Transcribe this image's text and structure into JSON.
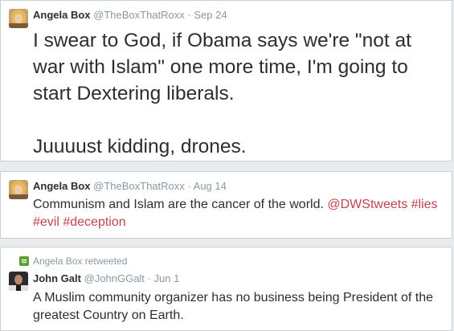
{
  "tweets": [
    {
      "author": "Angela Box",
      "handle": "@TheBoxThatRoxx",
      "separator": "·",
      "time": "Sep 24",
      "text": "I swear to God, if Obama says we're \"not at war with Islam\" one more time, I'm going to start Dextering liberals.\n\nJuuuust kidding, drones."
    },
    {
      "author": "Angela Box",
      "handle": "@TheBoxThatRoxx",
      "separator": "·",
      "time": "Aug 14",
      "text_plain": "Communism and Islam are the cancer of the world. ",
      "mention": "@DWStweets",
      "hashtags": [
        "#lies",
        "#evil",
        "#deception"
      ]
    },
    {
      "retweet_label": "Angela Box retweeted",
      "author": "John Galt",
      "handle": "@JohnGGalt",
      "separator": "·",
      "time": "Jun 1",
      "text": "A Muslim community organizer has no business being President of the greatest Country on Earth."
    }
  ],
  "icons": {
    "avatar_angela": "avatar-blonde-woman",
    "avatar_john": "avatar-dark-man",
    "retweet": "retweet-icon"
  },
  "colors": {
    "link": "#c0424f",
    "retweet_green": "#5c9e31",
    "meta_gray": "#8899a6",
    "text": "#292f33"
  }
}
